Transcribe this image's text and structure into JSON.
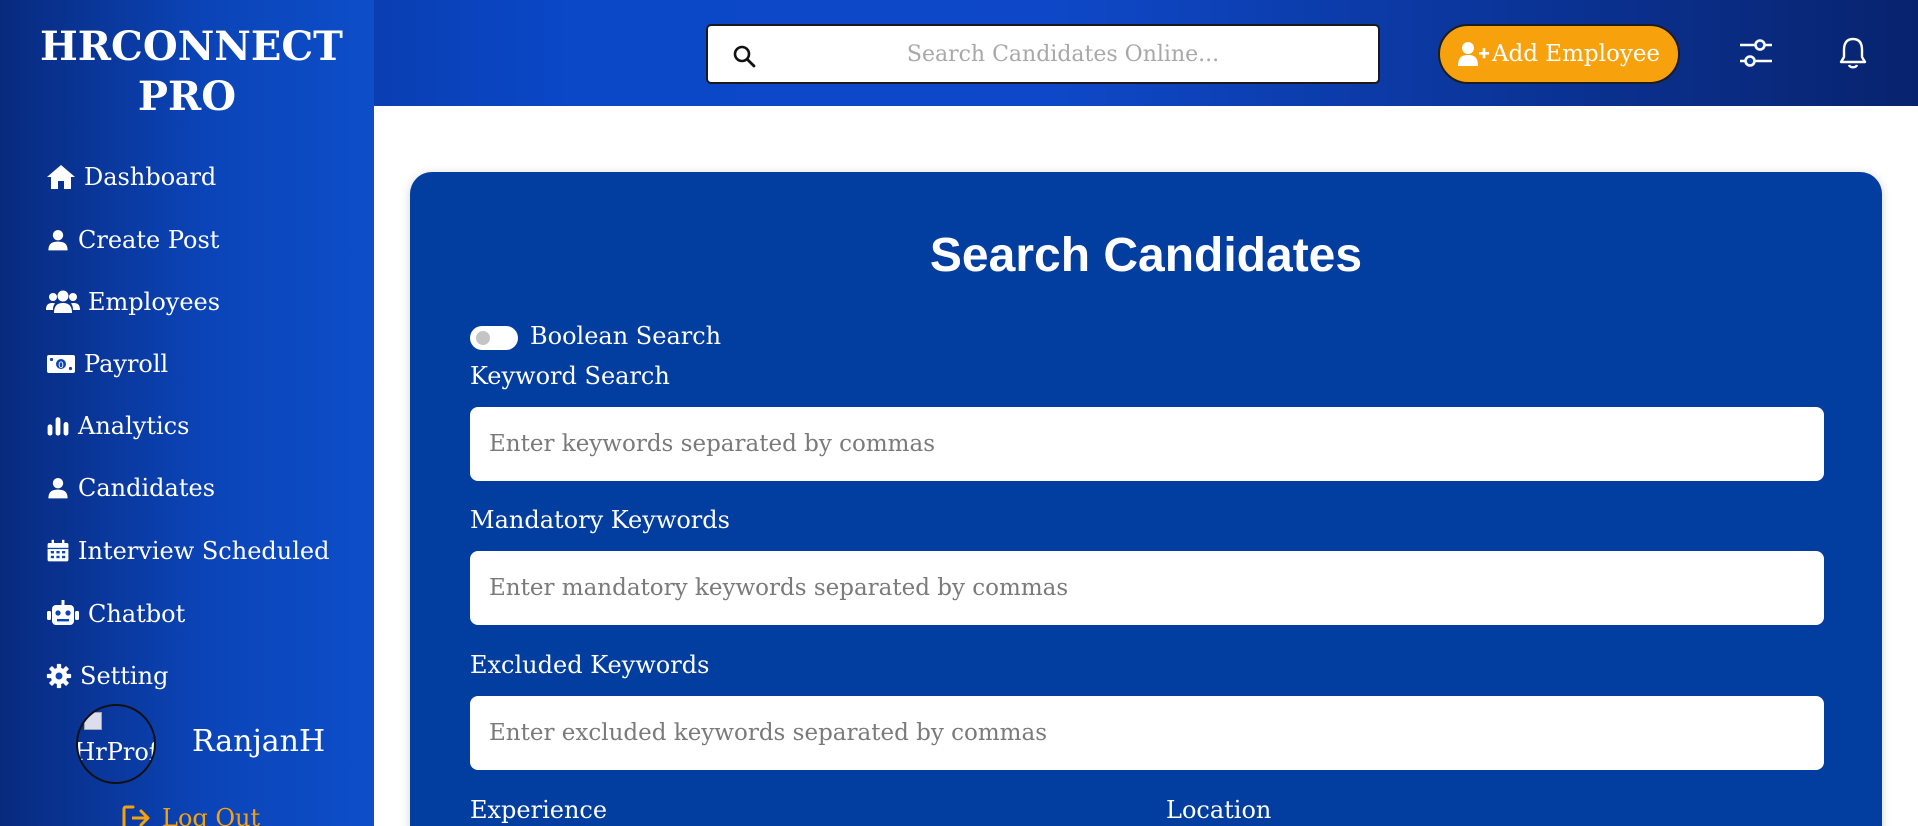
{
  "app": {
    "title": "HRCONNECT PRO"
  },
  "topbar": {
    "search_placeholder": "Search Candidates Online...",
    "add_button_label": "Add Employee"
  },
  "sidebar": {
    "items": [
      {
        "label": "Dashboard",
        "icon": "home-icon"
      },
      {
        "label": "Create Post",
        "icon": "user-icon"
      },
      {
        "label": "Employees",
        "icon": "users-icon"
      },
      {
        "label": "Payroll",
        "icon": "money-icon"
      },
      {
        "label": "Analytics",
        "icon": "bar-chart-icon"
      },
      {
        "label": "Candidates",
        "icon": "user-icon"
      },
      {
        "label": "Interview Scheduled",
        "icon": "calendar-icon"
      },
      {
        "label": "Chatbot",
        "icon": "robot-icon"
      },
      {
        "label": "Setting",
        "icon": "gear-icon"
      }
    ],
    "profile": {
      "avatar_alt": "HrProf",
      "username": "RanjanH"
    },
    "logout_label": "Log Out"
  },
  "main": {
    "title": "Search Candidates",
    "boolean_search_label": "Boolean Search",
    "boolean_search_enabled": false,
    "fields": {
      "keyword": {
        "label": "Keyword Search",
        "placeholder": "Enter keywords separated by commas",
        "value": ""
      },
      "mandatory": {
        "label": "Mandatory Keywords",
        "placeholder": "Enter mandatory keywords separated by commas",
        "value": ""
      },
      "excluded": {
        "label": "Excluded Keywords",
        "placeholder": "Enter excluded keywords separated by commas",
        "value": ""
      }
    },
    "experience_label": "Experience",
    "location_label": "Location"
  },
  "colors": {
    "brand_blue": "#023da0",
    "accent_orange": "#f7a20d",
    "sidebar_blue": "#0b44b8"
  }
}
